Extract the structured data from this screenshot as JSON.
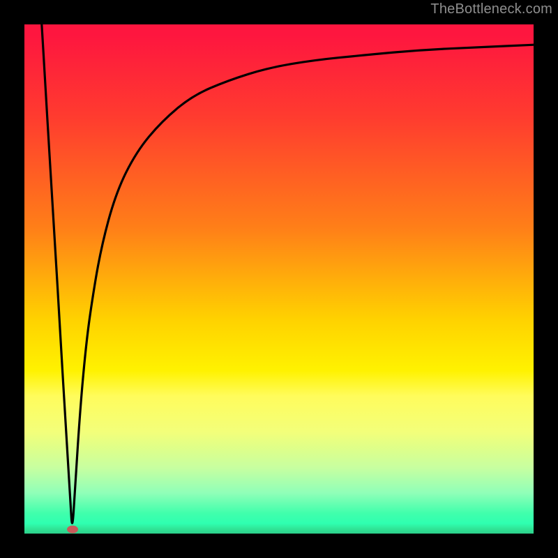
{
  "watermark": "TheBottleneck.com",
  "marker": {
    "x_pct": 9.4,
    "y_pct": 99.2,
    "color": "#c85a5a"
  },
  "chart_data": {
    "type": "line",
    "title": "",
    "xlabel": "",
    "ylabel": "",
    "xlim": [
      0,
      100
    ],
    "ylim": [
      0,
      100
    ],
    "grid": false,
    "legend": false,
    "series": [
      {
        "name": "bottleneck-curve",
        "x": [
          3.4,
          4.0,
          5.0,
          6.0,
          7.0,
          8.0,
          9.0,
          9.4,
          10.0,
          11.0,
          12.0,
          13.0,
          15.0,
          18.0,
          22.0,
          27.0,
          33.0,
          40.0,
          48.0,
          57.0,
          67.0,
          78.0,
          89.0,
          100.0
        ],
        "y": [
          100,
          90,
          73,
          57,
          40,
          23,
          7,
          0,
          10,
          25,
          36,
          44,
          56,
          67,
          75,
          81,
          86,
          89,
          91.5,
          93,
          94,
          95,
          95.5,
          96
        ]
      }
    ],
    "annotations": [
      {
        "type": "point",
        "x": 9.4,
        "y": 0,
        "label": "",
        "color": "#c85a5a"
      }
    ],
    "background": "gradient-red-yellow-green"
  }
}
